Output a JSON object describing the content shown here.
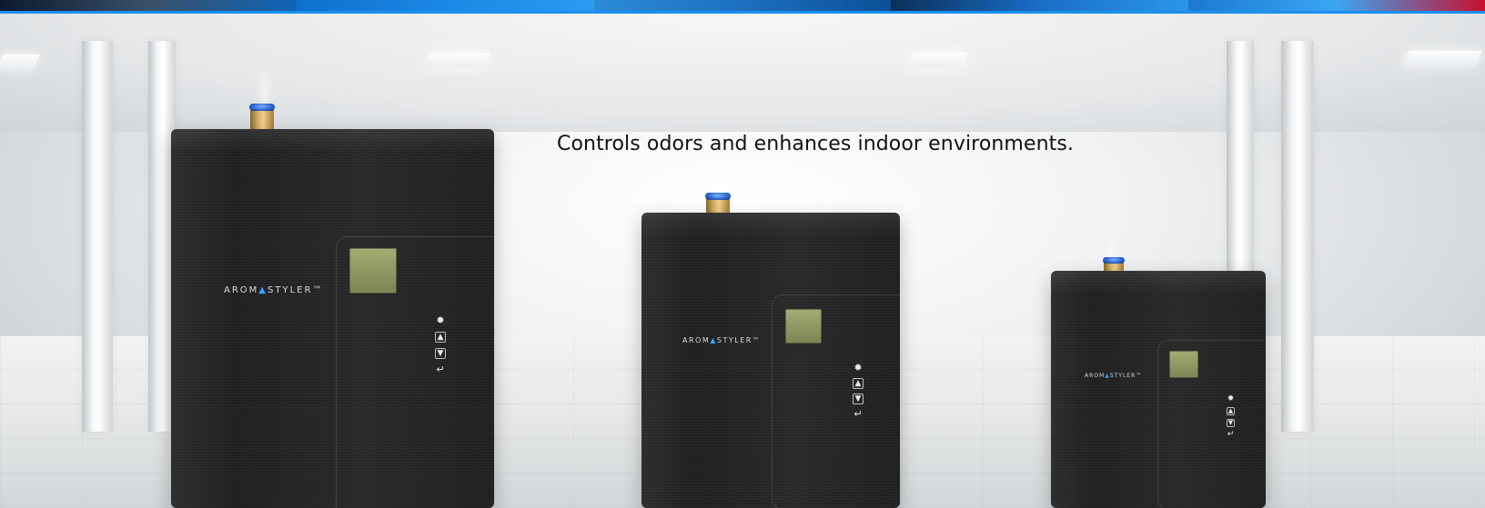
{
  "hero": {
    "tagline": "Controls odors and enhances indoor environments."
  },
  "products": [
    {
      "brand_prefix": "AROM",
      "brand_accent": "▲",
      "brand_suffix": "STYLER™",
      "buttons": [
        "gear-icon",
        "up-icon",
        "down-icon",
        "enter-icon"
      ]
    },
    {
      "brand_prefix": "AROM",
      "brand_accent": "▲",
      "brand_suffix": "STYLER™",
      "buttons": [
        "gear-icon",
        "up-icon",
        "down-icon",
        "enter-icon"
      ]
    },
    {
      "brand_prefix": "AROM",
      "brand_accent": "▲",
      "brand_suffix": "STYLER™",
      "buttons": [
        "gear-icon",
        "up-icon",
        "down-icon",
        "enter-icon"
      ]
    }
  ],
  "colors": {
    "accent_blue": "#1a90f0",
    "device_black": "#1f2021",
    "lcd_green": "#9aa26a"
  }
}
